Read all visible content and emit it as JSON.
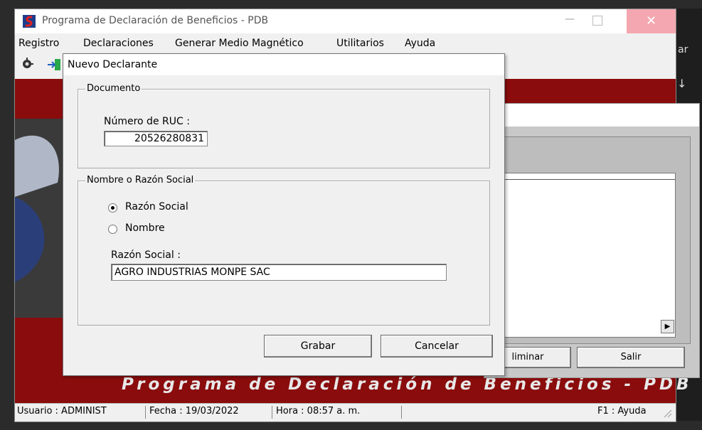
{
  "app": {
    "title": "Programa de Declaración de Beneficios - PDB",
    "banner": "Programa de Declaración de Beneficios - PDB"
  },
  "menu": [
    "Registro",
    "Declaraciones",
    "Generar Medio Magnético",
    "Utilitarios",
    "Ayuda"
  ],
  "background": {
    "right_fragment": "ar",
    "arrow": "↓",
    "eliminar_label": "liminar",
    "salir_label": "Salir"
  },
  "dialog": {
    "title": "Nuevo Declarante",
    "documento_group": "Documento",
    "ruc_label": "Número de RUC :",
    "ruc_value": "20526280831",
    "nombre_group": "Nombre o Razón Social",
    "radio_razon": "Razón Social",
    "radio_nombre": "Nombre",
    "razon_label": "Razón Social :",
    "razon_value": "AGRO INDUSTRIAS MONPE SAC",
    "grabar": "Grabar",
    "cancelar": "Cancelar"
  },
  "status": {
    "usuario": "Usuario : ADMINIST",
    "fecha": "Fecha : 19/03/2022",
    "hora": "Hora : 08:57 a. m.",
    "ayuda": "F1 : Ayuda"
  },
  "colors": {
    "maroon": "#8a0c0c",
    "close": "#f4a7b0"
  },
  "icons": [
    "app-logo-icon",
    "minimize-icon",
    "maximize-icon",
    "close-icon",
    "toolbar-tool-icon",
    "toolbar-exit-icon",
    "scroll-right-icon",
    "resize-grip-icon"
  ]
}
